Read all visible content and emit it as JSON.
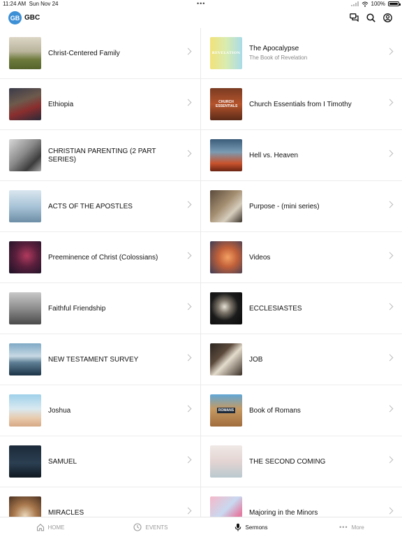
{
  "status_bar": {
    "time": "11:24 AM",
    "date": "Sun Nov 24",
    "battery": "100%"
  },
  "header": {
    "logo_text": "GB",
    "title": "GBC"
  },
  "left_items": [
    {
      "title": "Christ-Centered Family",
      "subtitle": ""
    },
    {
      "title": "Ethiopia",
      "subtitle": ""
    },
    {
      "title": "CHRISTIAN PARENTING (2 PART SERIES)",
      "subtitle": ""
    },
    {
      "title": "ACTS OF THE APOSTLES",
      "subtitle": ""
    },
    {
      "title": "Preeminence of Christ (Colossians)",
      "subtitle": ""
    },
    {
      "title": "Faithful Friendship",
      "subtitle": ""
    },
    {
      "title": "NEW TESTAMENT SURVEY",
      "subtitle": ""
    },
    {
      "title": "Joshua",
      "subtitle": ""
    },
    {
      "title": "SAMUEL",
      "subtitle": ""
    },
    {
      "title": "MIRACLES",
      "subtitle": ""
    }
  ],
  "right_items": [
    {
      "title": "The Apocalypse",
      "subtitle": "The Book of Revelation",
      "thumb_text": "REVELATION"
    },
    {
      "title": "Church Essentials from I Timothy",
      "subtitle": "",
      "thumb_text": "CHURCH ESSENTIALS"
    },
    {
      "title": "Hell vs. Heaven",
      "subtitle": "",
      "thumb_text": ""
    },
    {
      "title": "Purpose - (mini series)",
      "subtitle": "",
      "thumb_text": ""
    },
    {
      "title": "Videos",
      "subtitle": "",
      "thumb_text": ""
    },
    {
      "title": "ECCLESIASTES",
      "subtitle": "",
      "thumb_text": ""
    },
    {
      "title": "JOB",
      "subtitle": "",
      "thumb_text": ""
    },
    {
      "title": "Book of Romans",
      "subtitle": "",
      "thumb_text": "ROMANS"
    },
    {
      "title": "THE SECOND COMING",
      "subtitle": "",
      "thumb_text": ""
    },
    {
      "title": "Majoring in the Minors",
      "subtitle": "",
      "thumb_text": ""
    }
  ],
  "tabs": [
    {
      "label": "HOME",
      "icon": "home-icon",
      "active": false
    },
    {
      "label": "EVENTS",
      "icon": "clock-icon",
      "active": false
    },
    {
      "label": "Sermons",
      "icon": "microphone-icon",
      "active": true
    },
    {
      "label": "More",
      "icon": "more-icon",
      "active": false
    }
  ],
  "colors": {
    "accent": "#3d8fd6",
    "text": "#111111",
    "muted": "#9a9a9a"
  }
}
